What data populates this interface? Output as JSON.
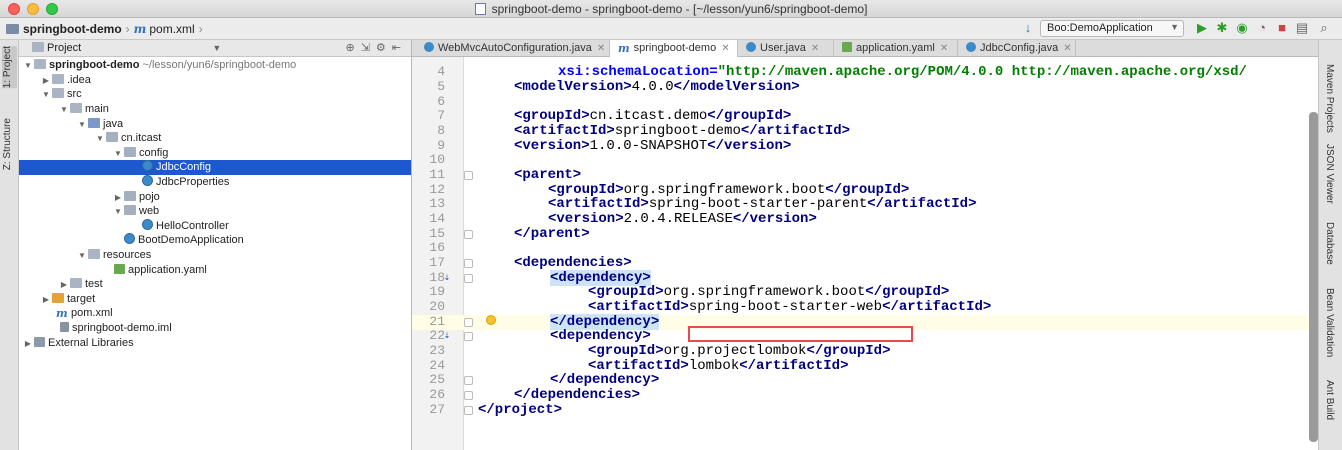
{
  "window": {
    "title": "springboot-demo - springboot-demo - [~/lesson/yun6/springboot-demo]"
  },
  "breadcrumb": {
    "project": "springboot-demo",
    "file": "pom.xml"
  },
  "toolbar": {
    "run_config": "Boo:DemoApplication"
  },
  "left_tools": {
    "project_tab": "1: Project",
    "structure_tab": "Z: Structure"
  },
  "right_tools": {
    "maven": "Maven Projects",
    "json": "JSON Viewer",
    "database": "Database",
    "bean": "Bean Validation",
    "ant": "Ant Build"
  },
  "project_panel": {
    "title": "Project",
    "tree": [
      {
        "label": "springboot-demo",
        "extra": "~/lesson/yun6/springboot-demo"
      },
      {
        "label": ".idea"
      },
      {
        "label": "src"
      },
      {
        "label": "main"
      },
      {
        "label": "java"
      },
      {
        "label": "cn.itcast"
      },
      {
        "label": "config"
      },
      {
        "label": "JdbcConfig"
      },
      {
        "label": "JdbcProperties"
      },
      {
        "label": "pojo"
      },
      {
        "label": "web"
      },
      {
        "label": "HelloController"
      },
      {
        "label": "BootDemoApplication"
      },
      {
        "label": "resources"
      },
      {
        "label": "application.yaml"
      },
      {
        "label": "test"
      },
      {
        "label": "target"
      },
      {
        "label": "pom.xml"
      },
      {
        "label": "springboot-demo.iml"
      },
      {
        "label": "External Libraries"
      }
    ]
  },
  "tabs": [
    {
      "label": "WebMvcAutoConfiguration.java"
    },
    {
      "label": "springboot-demo"
    },
    {
      "label": "User.java"
    },
    {
      "label": "application.yaml"
    },
    {
      "label": "JdbcConfig.java"
    }
  ],
  "code": {
    "line_numbers": [
      "4",
      "5",
      "6",
      "7",
      "8",
      "9",
      "10",
      "11",
      "12",
      "13",
      "14",
      "15",
      "16",
      "17",
      "18",
      "19",
      "20",
      "21",
      "22",
      "23",
      "24",
      "25",
      "26",
      "27"
    ],
    "line4_attr": "xsi:schemaLocation=",
    "line4_value": "\"http://maven.apache.org/POM/4.0.0 http://maven.apache.org/xsd/",
    "modelVersion": "4.0.0",
    "groupId": "cn.itcast.demo",
    "artifactId": "springboot-demo",
    "version": "1.0.0-SNAPSHOT",
    "parent_groupId": "org.springframework.boot",
    "parent_artifactId": "spring-boot-starter-parent",
    "parent_version": "2.0.4.RELEASE",
    "dep1_groupId": "org.springframework.boot",
    "dep1_artifactId": "spring-boot-starter-web",
    "dep2_groupId": "org.projectlombok",
    "dep2_artifactId": "lombok"
  }
}
